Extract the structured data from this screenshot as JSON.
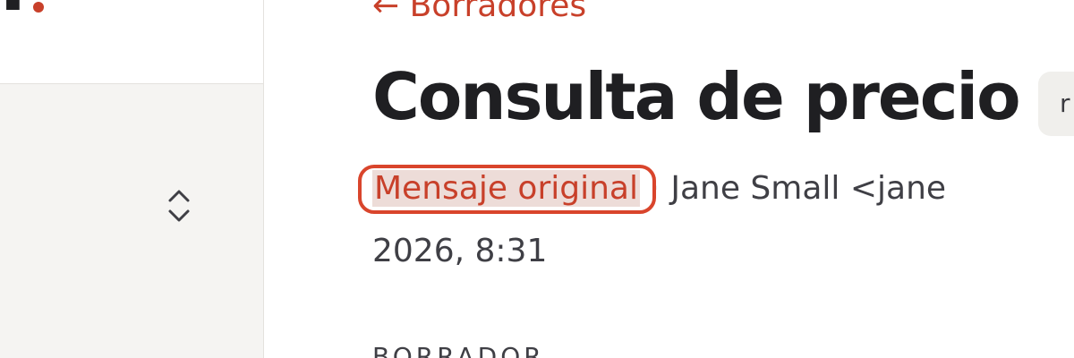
{
  "sidebar": {
    "logo_text": "r",
    "switcher_icon": "chevron-up-down-icon"
  },
  "header": {
    "back_link": "← Borradores",
    "title": "Consulta de precio",
    "tag_chip": "r"
  },
  "message": {
    "original_link": "Mensaje original",
    "separator": " · ",
    "sender": "Jane Small <jane",
    "date_time": "2026, 8:31"
  },
  "section": {
    "label": "BORRADOR"
  },
  "colors": {
    "accent": "#c8402a",
    "highlight_ring": "#d9452c",
    "sidebar_bg": "#f5f4f2"
  }
}
